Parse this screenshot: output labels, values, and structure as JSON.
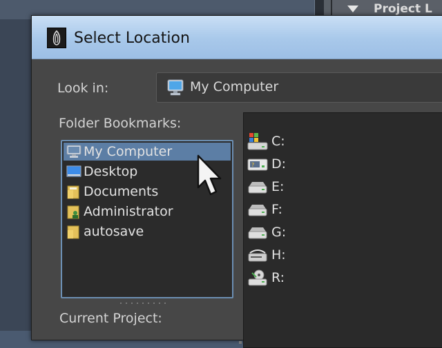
{
  "background_app": {
    "panel_title": "Project L"
  },
  "dialog": {
    "title": "Select Location",
    "look_in": {
      "label": "Look in:",
      "value": "My Computer",
      "icon": "computer-icon"
    },
    "folder_bookmarks": {
      "label": "Folder Bookmarks:",
      "selected_index": 0,
      "items": [
        {
          "label": "My Computer",
          "icon": "computer-icon"
        },
        {
          "label": "Desktop",
          "icon": "desktop-icon"
        },
        {
          "label": "Documents",
          "icon": "documents-folder-icon"
        },
        {
          "label": "Administrator",
          "icon": "user-folder-icon"
        },
        {
          "label": "autosave",
          "icon": "folder-icon"
        }
      ]
    },
    "current_project": {
      "label": "Current Project:"
    },
    "drives": [
      {
        "label": "C:",
        "icon": "system-drive-icon"
      },
      {
        "label": "D:",
        "icon": "network-drive-icon"
      },
      {
        "label": "E:",
        "icon": "hard-drive-icon"
      },
      {
        "label": "F:",
        "icon": "hard-drive-icon"
      },
      {
        "label": "G:",
        "icon": "hard-drive-icon"
      },
      {
        "label": "H:",
        "icon": "removable-drive-icon"
      },
      {
        "label": "R:",
        "icon": "optical-drive-icon"
      }
    ]
  },
  "colors": {
    "titlebar": "#a8c8ea",
    "dialog_bg": "#474747",
    "list_bg": "#2b2b2b",
    "selection": "#5c7ea5",
    "text": "#e2e2e2"
  }
}
